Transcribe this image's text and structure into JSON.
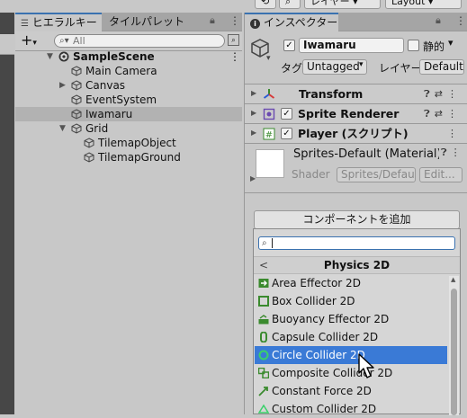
{
  "toolbar": {
    "layers_label": "レイヤー",
    "layout_label": "Layout"
  },
  "hierarchy": {
    "tabs": [
      "ヒエラルキー",
      "タイルパレット"
    ],
    "add_label": "+",
    "search_placeholder": "All",
    "items": [
      {
        "label": "SampleScene"
      },
      {
        "label": "Main Camera"
      },
      {
        "label": "Canvas"
      },
      {
        "label": "EventSystem"
      },
      {
        "label": "Iwamaru"
      },
      {
        "label": "Grid"
      },
      {
        "label": "TilemapObject"
      },
      {
        "label": "TilemapGround"
      }
    ]
  },
  "inspector": {
    "tab": "インスペクター",
    "object_name": "Iwamaru",
    "static_label": "静的",
    "tag_label": "タグ",
    "tag_value": "Untagged",
    "layer_label": "レイヤー",
    "layer_value": "Default",
    "components": [
      "Transform",
      "Sprite Renderer",
      "Player (スクリプト)"
    ],
    "material_name": "Sprites-Default (Material)",
    "shader_label": "Shader",
    "shader_value": "Sprites/Default",
    "edit_label": "Edit...",
    "add_component_label": "コンポーネントを追加"
  },
  "add_component": {
    "category": "Physics 2D",
    "back_glyph": "<",
    "selected_index": 4,
    "items": [
      "Area Effector 2D",
      "Box Collider 2D",
      "Buoyancy Effector 2D",
      "Capsule Collider 2D",
      "Circle Collider 2D",
      "Composite Collider 2D",
      "Constant Force 2D",
      "Custom Collider 2D"
    ]
  },
  "colors": {
    "selection": "#3a7ad6",
    "accent_green": "#3a8a2e"
  }
}
